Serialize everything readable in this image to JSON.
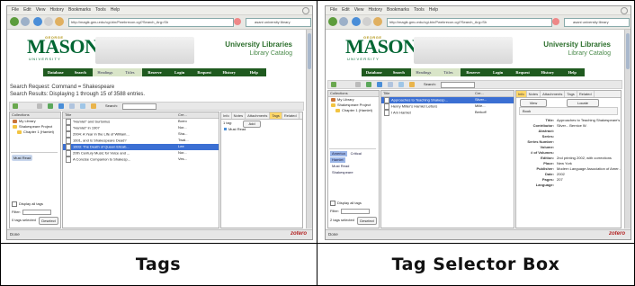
{
  "captions": {
    "left": "Tags",
    "right": "Tag Selector Box"
  },
  "browser": {
    "menu": [
      "File",
      "Edit",
      "View",
      "History",
      "Bookmarks",
      "Tools",
      "Help"
    ],
    "url": "http://magik.gmu.edu/cgi-bin/Pwebrecon.cgi?Search_Arg=Sh",
    "search_placeholder": "asani university library",
    "status": "Done",
    "zotero_label": "zotero"
  },
  "library": {
    "logo": "MASON",
    "logo_top": "GEORGE",
    "logo_bottom": "UNIVERSITY",
    "title": "University Libraries",
    "subtitle": "Library Catalog",
    "nav": [
      "Database",
      "Search",
      "Headings",
      "Titles",
      "Reserve",
      "Login",
      "Request",
      "History",
      "Help"
    ],
    "search_request": "Search Request: Command = Shakespeare",
    "search_results": "Search Results: Displaying 1 through 15 of 3588 entries."
  },
  "left": {
    "toolbar_search": "Search:",
    "collections_header": "Collections",
    "collections": [
      "My Library",
      "Shakespeare Project",
      "Chapter 1 (Hamlet)"
    ],
    "must_read": "Must Read",
    "display_all_tags": "Display all tags",
    "filter_label": "Filter:",
    "tags_selected": "0 tags selected",
    "deselect": "Deselect",
    "items_header_title": "Title",
    "items_header_creator": "Cre...",
    "items": [
      {
        "title": "\"Hamlet\" and Surtonius",
        "creator": "Borro"
      },
      {
        "title": "\"Hamlet\" in 1907",
        "creator": "Nor..."
      },
      {
        "title": "2004: A Year in the Life of William...",
        "creator": "Sha..."
      },
      {
        "title": "1601, and Is Shakespeare Dead?",
        "creator": "Twai..."
      },
      {
        "title": "1603: The Death of Queen Elizab...",
        "creator": "Lee"
      },
      {
        "title": "20th Century Music for Voice and ...",
        "creator": "Nor..."
      },
      {
        "title": "A Concise Companion to Shakesp...",
        "creator": "Ves..."
      }
    ],
    "selected_item_index": 4,
    "info_tabs": [
      "Info",
      "Notes",
      "Attachments",
      "Tags",
      "Related"
    ],
    "active_tab": "Tags",
    "tag_count": "1 tag:",
    "add_label": "Add",
    "tag_value": "Must Read"
  },
  "right": {
    "toolbar_search": "Search:",
    "collections_header": "Collections",
    "collections": [
      "My Library",
      "Shakespeare Project",
      "Chapter 1 (Hamlet)"
    ],
    "tag_selector_tags": [
      "America",
      "Critical",
      "Hamlet",
      "Must Read",
      "Shakespeare"
    ],
    "tag_selector_active": [
      "America",
      "Hamlet"
    ],
    "display_all_tags": "Display all tags",
    "filter_label": "Filter:",
    "tags_selected": "2 tags selected",
    "deselect": "Deselect",
    "items_header_title": "Title",
    "items_header_creator": "Cre...",
    "items": [
      {
        "title": "Approaches to Teaching Shakesp...",
        "creator": "Sliver..."
      },
      {
        "title": "Henry Miller's Hamlet Letters",
        "creator": "Mille..."
      },
      {
        "title": "I Am Hamlet",
        "creator": "Berkoff"
      }
    ],
    "selected_item_index": 0,
    "info_tabs": [
      "Info",
      "Notes",
      "Attachments",
      "Tags",
      "Related"
    ],
    "active_tab": "Info",
    "view_label": "View",
    "locate_label": "Locate",
    "item_type": "Book",
    "fields": [
      {
        "label": "Title:",
        "value": "Approaches to Teaching Shakespeare's Hamlet"
      },
      {
        "label": "Contributor:",
        "value": "Sliver... Bernice W."
      },
      {
        "label": "Abstract:",
        "value": ""
      },
      {
        "label": "Series:",
        "value": ""
      },
      {
        "label": "Series Number:",
        "value": ""
      },
      {
        "label": "Volume:",
        "value": ""
      },
      {
        "label": "# of Volumes:",
        "value": ""
      },
      {
        "label": "Edition:",
        "value": "2nd printing 2002, with corrections"
      },
      {
        "label": "Place:",
        "value": "New York"
      },
      {
        "label": "Publisher:",
        "value": "Modern Language Association of Amer..."
      },
      {
        "label": "Date:",
        "value": "2002"
      },
      {
        "label": "Pages:",
        "value": "207"
      },
      {
        "label": "Language:",
        "value": ""
      }
    ]
  },
  "colors": {
    "mason_green": "#006633",
    "nav_green": "#1f5a1f",
    "selection_blue": "#3b6fd3",
    "active_tab": "#ffd76b"
  }
}
